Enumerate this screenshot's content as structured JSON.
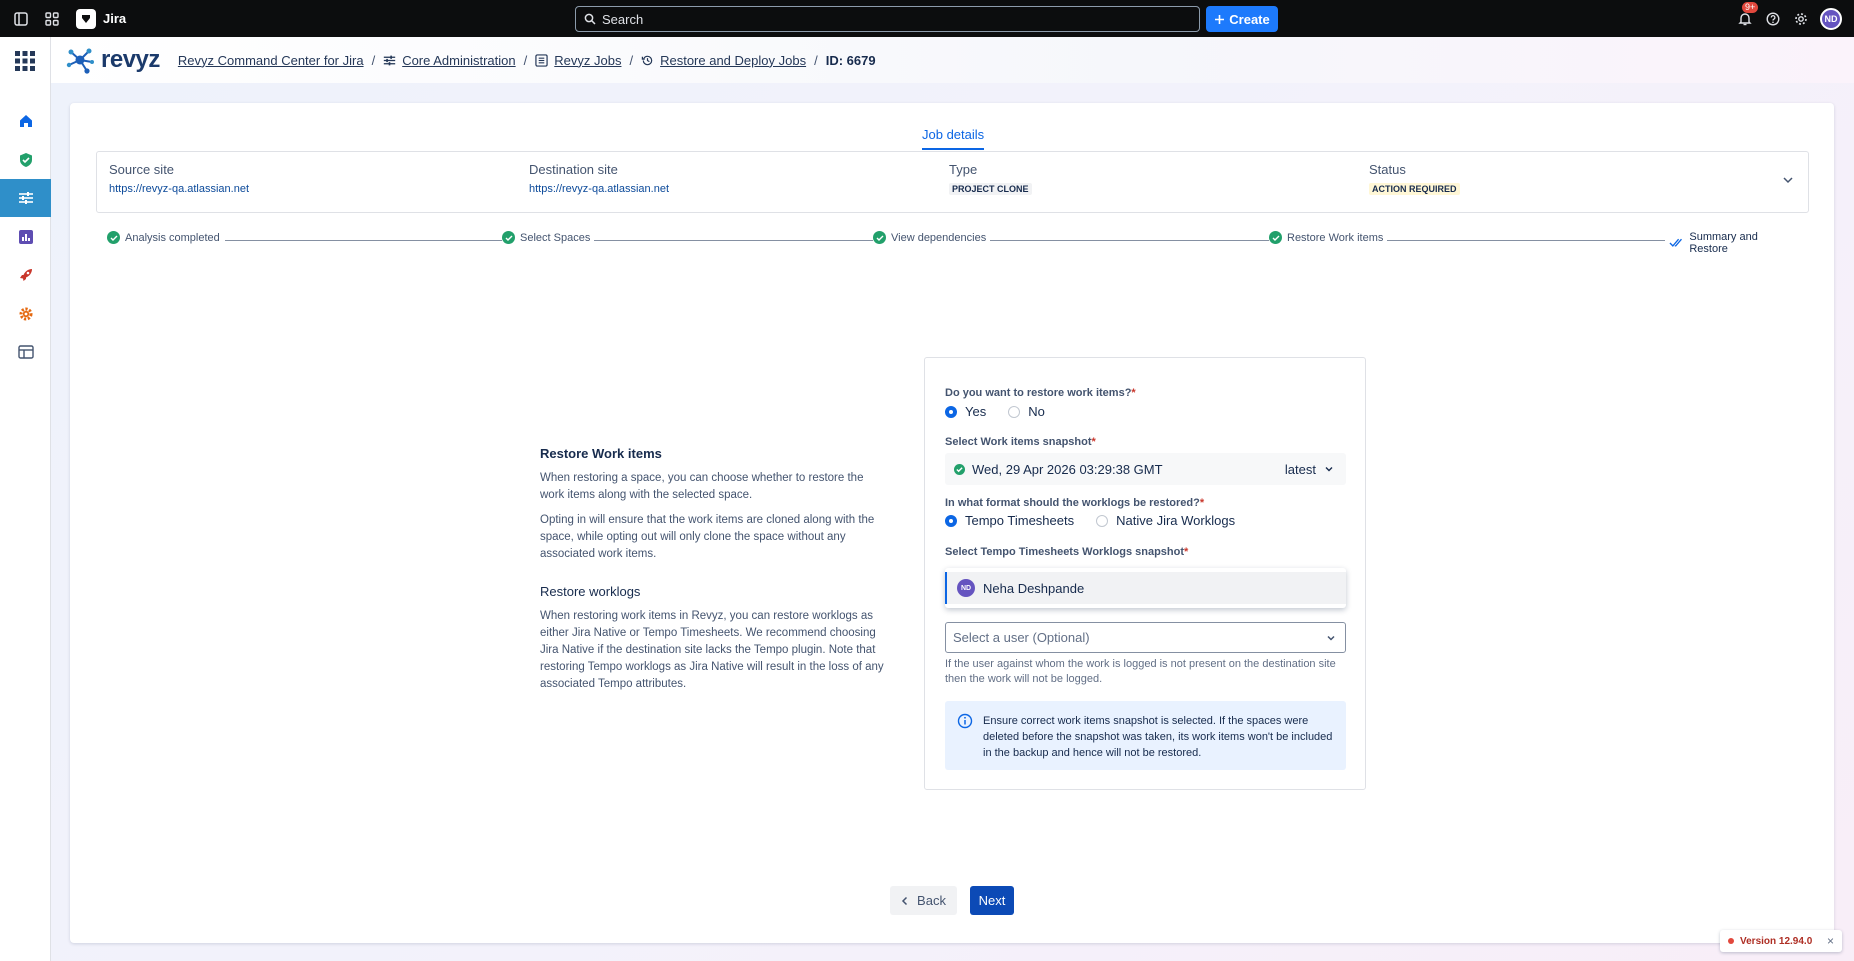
{
  "topbar": {
    "app_name": "Jira",
    "search_placeholder": "Search",
    "create_label": "Create",
    "notification_count": "9+",
    "avatar_initials": "ND"
  },
  "header": {
    "brand": "revyz",
    "breadcrumbs": [
      {
        "label": "Revyz Command Center for Jira"
      },
      {
        "label": "Core Administration"
      },
      {
        "label": "Revyz Jobs"
      },
      {
        "label": "Restore and Deploy Jobs"
      }
    ],
    "current": "ID: 6679"
  },
  "tabs": {
    "job_details": "Job details"
  },
  "summary": {
    "source_label": "Source site",
    "source_value": "https://revyz-qa.atlassian.net",
    "dest_label": "Destination site",
    "dest_value": "https://revyz-qa.atlassian.net",
    "type_label": "Type",
    "type_value": "PROJECT CLONE",
    "status_label": "Status",
    "status_value": "ACTION REQUIRED"
  },
  "steps": [
    {
      "label": "Analysis completed",
      "state": "done"
    },
    {
      "label": "Select Spaces",
      "state": "done"
    },
    {
      "label": "View dependencies",
      "state": "done"
    },
    {
      "label": "Restore Work items",
      "state": "done"
    },
    {
      "label": "Summary and Restore",
      "state": "current"
    }
  ],
  "description": {
    "title": "Restore Work items",
    "p1": "When restoring a space, you can choose whether to restore the work items along with the selected space.",
    "p2": "Opting in will ensure that the work items are cloned along with the space, while opting out will only clone the space without any associated work items.",
    "title2": "Restore worklogs",
    "p3": "When restoring work items in Revyz, you can restore worklogs as either Jira Native or Tempo Timesheets. We recommend choosing Jira Native if the destination site lacks the Tempo plugin. Note that restoring Tempo worklogs as Jira Native will result in the loss of any associated Tempo attributes."
  },
  "form": {
    "q1": "Do you want to restore work items?",
    "q1_yes": "Yes",
    "q1_no": "No",
    "q2": "Select Work items snapshot",
    "snapshot_value": "Wed, 29 Apr 2026 03:29:38 GMT",
    "snapshot_tag": "latest",
    "q3": "In what format should the worklogs be restored?",
    "q3_opt1": "Tempo Timesheets",
    "q3_opt2": "Native Jira Worklogs",
    "q4": "Select Tempo Timesheets Worklogs snapshot",
    "dropdown_option": "Neha Deshpande",
    "dropdown_option_initials": "ND",
    "user_placeholder": "Select a user (Optional)",
    "help_text": "If the user against whom the work is logged is not present on the destination site then the work will not be logged.",
    "info_text": "Ensure correct work items snapshot is selected. If the spaces were deleted before the snapshot was taken, its work items won't be included in the backup and hence will not be restored."
  },
  "buttons": {
    "back": "Back",
    "next": "Next"
  },
  "version": "Version 12.94.0"
}
